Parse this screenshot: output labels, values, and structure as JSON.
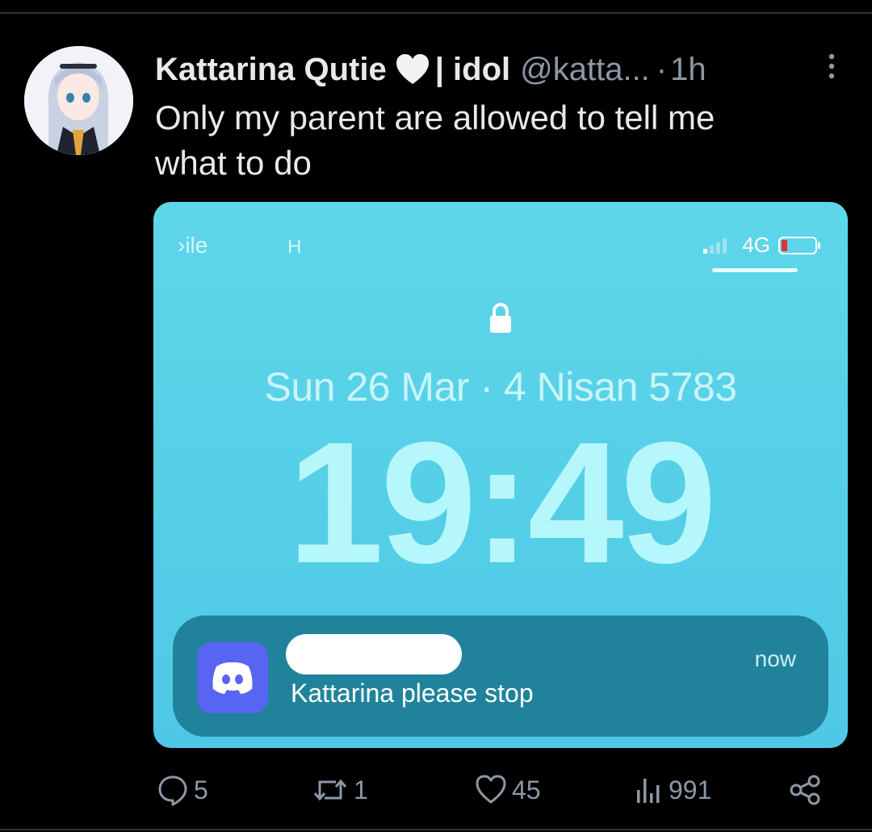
{
  "tweet": {
    "display_name": "Kattarina Qutie",
    "name_suffix": "| idol",
    "handle": "@katta...",
    "separator": "·",
    "time": "1h",
    "text_line1": "Only my parent are allowed to tell me",
    "text_line2": "what to do"
  },
  "media": {
    "carrier": "›ile",
    "carrier_2": "H",
    "network": "4G",
    "date": "Sun 26 Mar · 4 Nisan 5783",
    "clock": "19:49",
    "notification": {
      "app_icon": "discord-icon",
      "time": "now",
      "body": "Kattarina please stop"
    }
  },
  "actions": {
    "replies": "5",
    "retweets": "1",
    "likes": "45",
    "views": "991"
  },
  "colors": {
    "background": "#000000",
    "muted": "#8b98a5",
    "text": "#e7e9ea",
    "lockscreen": "#55cfe7",
    "notification": "#21839b",
    "discord": "#5865f2"
  }
}
